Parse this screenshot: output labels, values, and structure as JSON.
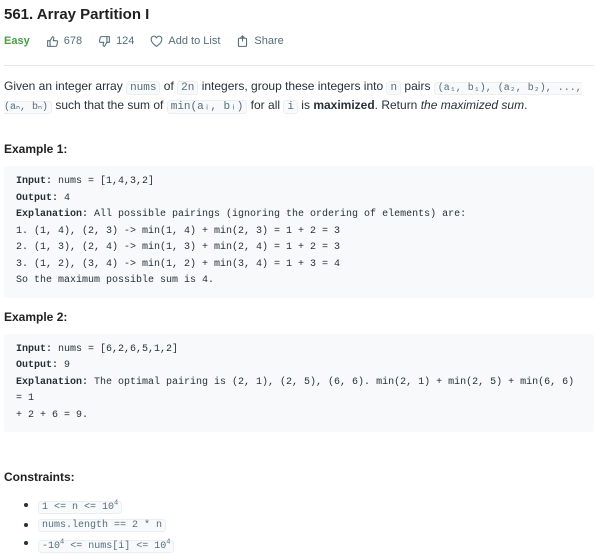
{
  "problem": {
    "title": "561. Array Partition I",
    "difficulty": "Easy",
    "likes": "678",
    "dislikes": "124",
    "add_to_list": "Add to List",
    "share": "Share"
  },
  "description": {
    "p1_a": "Given an integer array ",
    "p1_nums": "nums",
    "p1_b": " of ",
    "p1_2n": "2n",
    "p1_c": " integers, group these integers into ",
    "p1_n": "n",
    "p1_d": " pairs ",
    "p1_pairs": "(a₁, b₁), (a₂, b₂), ..., (aₙ, bₙ)",
    "p1_e": " such that the sum of ",
    "p1_min": "min(aᵢ, bᵢ)",
    "p1_f": " for all ",
    "p1_i": "i",
    "p1_g": " is ",
    "p1_max": "maximized",
    "p1_h": ". Return ",
    "p1_ret": "the maximized sum",
    "p1_end": "."
  },
  "examples": [
    {
      "heading": "Example 1:",
      "lines": [
        {
          "label": "Input:",
          "text": " nums = [1,4,3,2]"
        },
        {
          "label": "Output:",
          "text": " 4"
        },
        {
          "label": "Explanation:",
          "text": " All possible pairings (ignoring the ordering of elements) are:"
        },
        {
          "label": "",
          "text": "1. (1, 4), (2, 3) -> min(1, 4) + min(2, 3) = 1 + 2 = 3"
        },
        {
          "label": "",
          "text": "2. (1, 3), (2, 4) -> min(1, 3) + min(2, 4) = 1 + 2 = 3"
        },
        {
          "label": "",
          "text": "3. (1, 2), (3, 4) -> min(1, 2) + min(3, 4) = 1 + 3 = 4"
        },
        {
          "label": "",
          "text": "So the maximum possible sum is 4."
        }
      ]
    },
    {
      "heading": "Example 2:",
      "lines": [
        {
          "label": "Input:",
          "text": " nums = [6,2,6,5,1,2]"
        },
        {
          "label": "Output:",
          "text": " 9"
        },
        {
          "label": "Explanation:",
          "text": " The optimal pairing is (2, 1), (2, 5), (6, 6). min(2, 1) + min(2, 5) + min(6, 6) = 1"
        },
        {
          "label": "",
          "text": "+ 2 + 6 = 9."
        }
      ]
    }
  ],
  "constraints": {
    "heading": "Constraints:",
    "c1_a": "1 <= n <= 10",
    "c1_sup": "4",
    "c2": "nums.length == 2 * n",
    "c3_a": "-10",
    "c3_sup1": "4",
    "c3_b": " <= nums[i] <= 10",
    "c3_sup2": "4"
  },
  "colors": {
    "easy": "#43a047",
    "code_bg": "#f7f9fa"
  }
}
